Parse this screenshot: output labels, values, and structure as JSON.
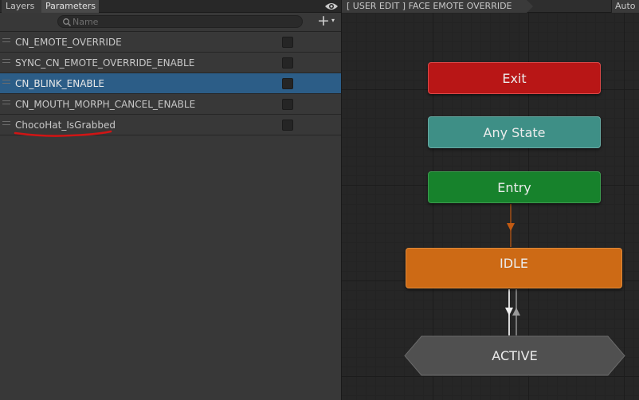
{
  "tabs": {
    "layers": "Layers",
    "parameters": "Parameters"
  },
  "search": {
    "placeholder": "Name",
    "value": ""
  },
  "add_button": {
    "plus": "+",
    "caret": "▾"
  },
  "parameters": [
    {
      "name": "CN_EMOTE_OVERRIDE",
      "checked": false,
      "selected": false
    },
    {
      "name": "SYNC_CN_EMOTE_OVERRIDE_ENABLE",
      "checked": false,
      "selected": false
    },
    {
      "name": "CN_BLINK_ENABLE",
      "checked": false,
      "selected": true
    },
    {
      "name": "CN_MOUTH_MORPH_CANCEL_ENABLE",
      "checked": false,
      "selected": false
    },
    {
      "name": "ChocoHat_IsGrabbed",
      "checked": false,
      "selected": false
    }
  ],
  "annotation_color": "#d01515",
  "graph": {
    "breadcrumb": "[ USER EDIT ] FACE EMOTE OVERRIDE",
    "auto_button": "Auto Live Link",
    "states": {
      "exit": "Exit",
      "any_state": "Any State",
      "entry": "Entry",
      "idle": "IDLE",
      "active": "ACTIVE"
    },
    "colors": {
      "exit": "#b81616",
      "any_state": "#3e8f86",
      "entry": "#17822c",
      "idle": "#cd6a15",
      "active": "#505050",
      "transition_entry": "#c25a12",
      "transition_idle": "#e0e0e0"
    }
  },
  "icons": {
    "eye": "eye-icon",
    "search": "search-icon",
    "handle": "drag-handle-icon"
  }
}
